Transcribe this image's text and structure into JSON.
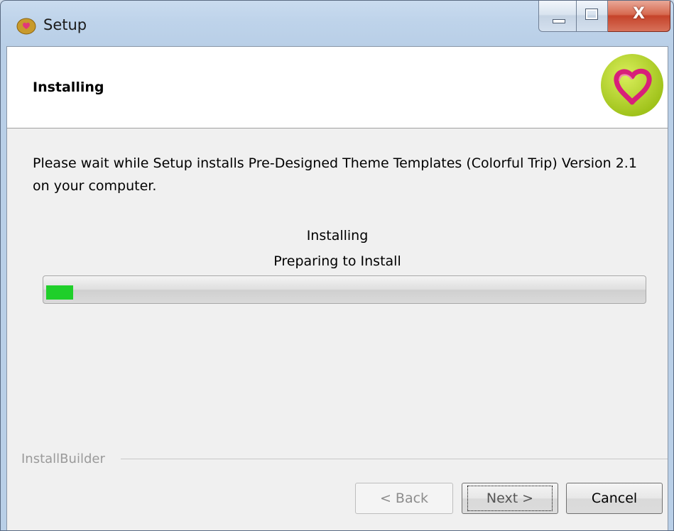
{
  "window": {
    "title": "Setup",
    "app_icon": "setup-app-icon",
    "controls": {
      "minimize": "minimize-icon",
      "maximize": "maximize-icon",
      "close": "close-icon",
      "close_glyph": "X"
    }
  },
  "header": {
    "title": "Installing",
    "logo": "heart-logo-icon"
  },
  "body": {
    "description": "Please wait while Setup installs Pre-Designed Theme Templates (Colorful Trip) Version 2.1 on your computer.",
    "status_line_1": "Installing",
    "status_line_2": "Preparing to Install",
    "progress_fraction": 0.045,
    "progress_color": "#1fcf2a"
  },
  "footer": {
    "brand": "InstallBuilder",
    "back_label": "< Back",
    "next_label": "Next >",
    "cancel_label": "Cancel"
  }
}
